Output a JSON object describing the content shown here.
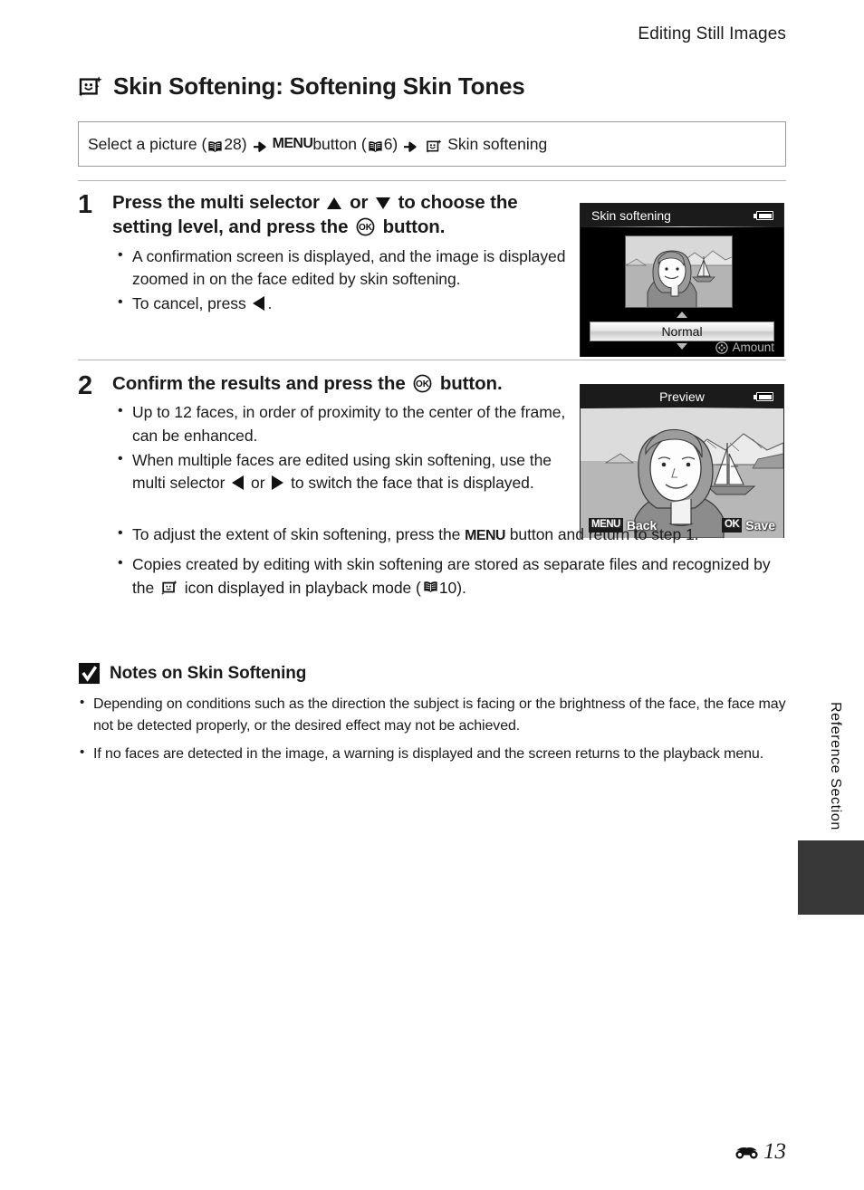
{
  "header": {
    "running_title": "Editing Still Images"
  },
  "title": {
    "icon": "skin-softening-icon",
    "text": "Skin Softening: Softening Skin Tones"
  },
  "path_bar": {
    "segment1": "Select a picture (",
    "ref1": "28",
    "close1": ")",
    "menu_word": "MENU",
    "segment2": " button (",
    "ref2": "6",
    "close2": ")",
    "segment3": "Skin softening"
  },
  "steps": [
    {
      "number": "1",
      "heading_a": "Press the multi selector ",
      "heading_b": " or ",
      "heading_c": " to choose the setting level, and press the ",
      "heading_d": " button.",
      "bullets": [
        {
          "text": "A confirmation screen is displayed, and the image is displayed zoomed in on the face edited by skin softening."
        },
        {
          "prefix": "To cancel, press ",
          "suffix": "."
        }
      ]
    },
    {
      "number": "2",
      "heading_a": "Confirm the results and press the ",
      "heading_d": " button.",
      "bullets": [
        {
          "text": "Up to 12 faces, in order of proximity to the center of the frame, can be enhanced."
        },
        {
          "prefix": "When multiple faces are edited using skin softening, use the multi selector ",
          "mid": " or ",
          "suffix": " to switch the face that is displayed."
        },
        {
          "prefix": "To adjust the extent of skin softening, press the ",
          "menu": "MENU",
          "suffix": " button and return to step 1."
        },
        {
          "prefix": "Copies created by editing with skin softening are stored as separate files and recognized by the ",
          "suffix": " icon displayed in playback mode (",
          "ref": "10",
          "close": ")."
        }
      ]
    }
  ],
  "screens": [
    {
      "name": "skin-softening-screen",
      "title": "Skin softening",
      "option_value": "Normal",
      "amount_label": "Amount"
    },
    {
      "name": "preview-screen",
      "title": "Preview",
      "left_badge": "MENU",
      "left_label": "Back",
      "right_badge": "OK",
      "right_label": "Save"
    }
  ],
  "notes": {
    "title": "Notes on Skin Softening",
    "items": [
      "Depending on conditions such as the direction the subject is facing or the brightness of the face, the face may not be detected properly, or the desired effect may not be achieved.",
      "If no faces are detected in the image, a warning is displayed and the screen returns to the playback menu."
    ]
  },
  "margin": {
    "section_label": "Reference Section"
  },
  "footer": {
    "page_number": "13"
  },
  "colors": {
    "rule": "#b3b3b3",
    "tab": "#383838",
    "screen_bg": "#000000"
  }
}
